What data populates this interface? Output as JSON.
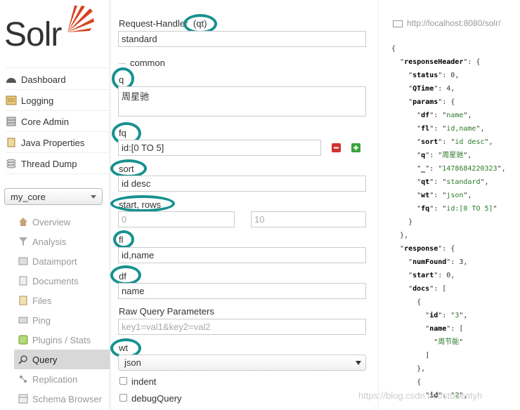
{
  "sidebar": {
    "logo": "Solr",
    "nav": [
      {
        "label": "Dashboard",
        "icon": "dashboard-icon"
      },
      {
        "label": "Logging",
        "icon": "logging-icon"
      },
      {
        "label": "Core Admin",
        "icon": "core-admin-icon"
      },
      {
        "label": "Java Properties",
        "icon": "java-properties-icon"
      },
      {
        "label": "Thread Dump",
        "icon": "thread-dump-icon"
      }
    ],
    "core_selector": "my_core",
    "core_menu": [
      {
        "label": "Overview",
        "icon": "overview-icon"
      },
      {
        "label": "Analysis",
        "icon": "analysis-icon"
      },
      {
        "label": "Dataimport",
        "icon": "dataimport-icon"
      },
      {
        "label": "Documents",
        "icon": "documents-icon"
      },
      {
        "label": "Files",
        "icon": "files-icon"
      },
      {
        "label": "Ping",
        "icon": "ping-icon"
      },
      {
        "label": "Plugins / Stats",
        "icon": "plugins-icon"
      },
      {
        "label": "Query",
        "icon": "query-icon",
        "active": true
      },
      {
        "label": "Replication",
        "icon": "replication-icon"
      },
      {
        "label": "Schema Browser",
        "icon": "schema-browser-icon"
      }
    ]
  },
  "form": {
    "request_handler_label": "Request-Handler",
    "qt_label": "(qt)",
    "request_handler_value": "standard",
    "common_legend": "common",
    "q_label": "q",
    "q_value": "周星驰",
    "fq_label": "fq",
    "fq_value": "id:[0 TO 5]",
    "sort_label": "sort",
    "sort_value": "id desc",
    "start_rows_label": "start, rows",
    "start_placeholder": "0",
    "rows_placeholder": "10",
    "fl_label": "fl",
    "fl_value": "id,name",
    "df_label": "df",
    "df_value": "name",
    "raw_label": "Raw Query Parameters",
    "raw_placeholder": "key1=val1&key2=val2",
    "wt_label": "wt",
    "wt_value": "json",
    "indent_label": "indent",
    "debug_label": "debugQuery"
  },
  "response": {
    "url": "http://localhost:8080/solr/",
    "json_lines": [
      "{",
      "  \"responseHeader\": {",
      "    \"status\": 0,",
      "    \"QTime\": 4,",
      "    \"params\": {",
      "      \"df\": \"name\",",
      "      \"fl\": \"id,name\",",
      "      \"sort\": \"id desc\",",
      "      \"q\": \"周星驰\",",
      "      \"_\": \"1478684220323\",",
      "      \"qt\": \"standard\",",
      "      \"wt\": \"json\",",
      "      \"fq\": \"id:[0 TO 5]\"",
      "    }",
      "  },",
      "  \"response\": {",
      "    \"numFound\": 3,",
      "    \"start\": 0,",
      "    \"docs\": [",
      "      {",
      "        \"id\": \"3\",",
      "        \"name\": [",
      "          \"周节能\"",
      "        ]",
      "      },",
      "      {",
      "        \"id\": \"2\","
    ]
  },
  "watermark": "https://blog.csdn.net/studentyh",
  "colors": {
    "highlight_circle": "#16918f",
    "logo_red": "#d9411e",
    "active_bg": "#d8d8d8"
  }
}
